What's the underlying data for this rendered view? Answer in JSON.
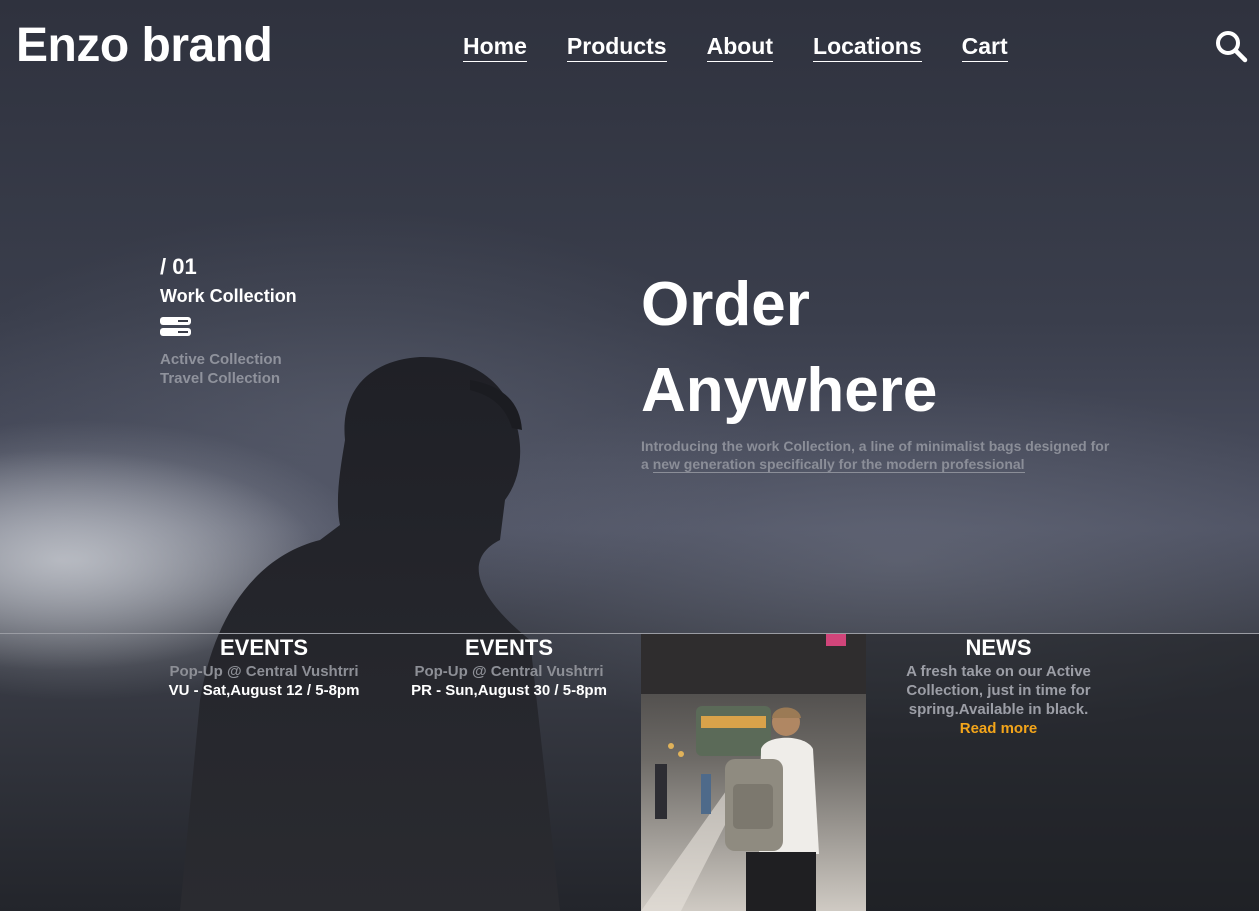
{
  "brand": {
    "name": "Enzo brand"
  },
  "nav": {
    "links": [
      "Home",
      "Products",
      "About",
      "Locations",
      "Cart"
    ],
    "search_icon": "search-icon"
  },
  "collections": {
    "number": "/ 01",
    "active_title": "Work Collection",
    "items": [
      "Active Collection",
      "Travel Collection"
    ]
  },
  "hero": {
    "headline_line1": "Order",
    "headline_line2": "Anywhere",
    "intro_text": "Introducing the work Collection, a line of minimalist bags designed for a",
    "intro_link": "new generation specifically for the modern professional"
  },
  "events": [
    {
      "heading": "EVENTS",
      "subtitle": "Pop-Up @ Central Vushtrri",
      "date": "VU - Sat,August 12 / 5-8pm"
    },
    {
      "heading": "EVENTS",
      "subtitle": "Pop-Up @ Central Vushtrri",
      "date": "PR - Sun,August 30 / 5-8pm"
    }
  ],
  "news": {
    "heading": "NEWS",
    "text_line1": "A fresh take on our Active",
    "text_line2": "Collection, just in time for",
    "text_line3": "spring.Available in black.",
    "read_more": "Read more"
  },
  "colors": {
    "accent": "#f3a51a",
    "text": "#ffffff",
    "muted": "#8d8f96"
  }
}
